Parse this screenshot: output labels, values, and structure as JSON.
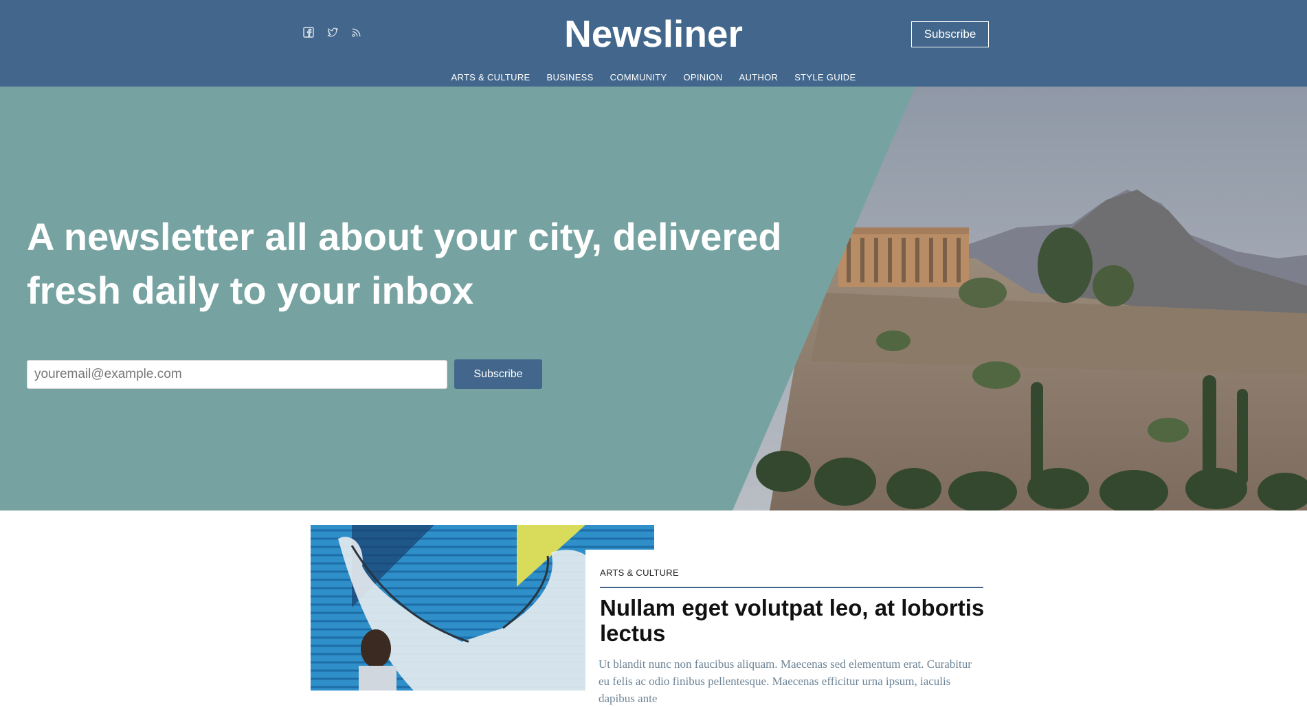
{
  "header": {
    "brand": "Newsliner",
    "subscribe_label": "Subscribe",
    "social": [
      {
        "icon": "facebook-icon"
      },
      {
        "icon": "twitter-icon"
      },
      {
        "icon": "rss-icon"
      }
    ],
    "nav": [
      "ARTS & CULTURE",
      "BUSINESS",
      "COMMUNITY",
      "OPINION",
      "AUTHOR",
      "STYLE GUIDE"
    ]
  },
  "hero": {
    "headline": "A newsletter all about your city, delivered fresh daily to your inbox",
    "email_placeholder": "youremail@example.com",
    "subscribe_label": "Subscribe",
    "photo": "acropolis-hill-photo"
  },
  "featured": {
    "category": "ARTS & CULTURE",
    "title": "Nullam eget volutpat leo, at lobortis lectus",
    "excerpt": "Ut blandit nunc non faucibus aliquam. Maecenas sed elementum erat. Curabitur eu felis ac odio finibus pellentesque. Maecenas efficitur urna ipsum, iaculis dapibus ante",
    "image": "street-mural-photo"
  },
  "colors": {
    "header_bg": "#43678c",
    "hero_bg": "#76a3a1",
    "accent": "#43678c",
    "excerpt_text": "#6e8597"
  }
}
